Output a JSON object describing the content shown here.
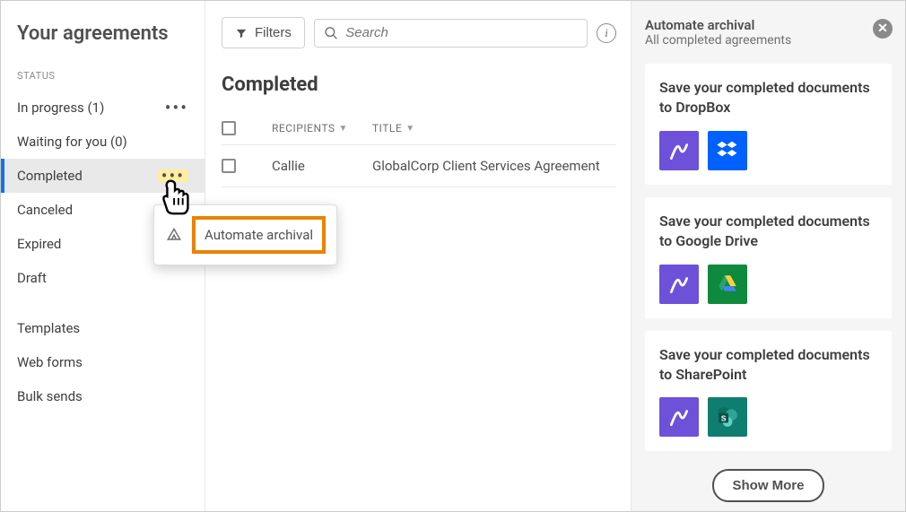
{
  "sidebar": {
    "title": "Your agreements",
    "status_label": "STATUS",
    "items": [
      {
        "label": "In progress (1)",
        "more": true
      },
      {
        "label": "Waiting for you (0)"
      },
      {
        "label": "Completed",
        "selected": true,
        "more_highlight": true
      },
      {
        "label": "Canceled"
      },
      {
        "label": "Expired"
      },
      {
        "label": "Draft"
      }
    ],
    "secondary": [
      {
        "label": "Templates"
      },
      {
        "label": "Web forms"
      },
      {
        "label": "Bulk sends"
      }
    ]
  },
  "toolbar": {
    "filters_label": "Filters",
    "search_placeholder": "Search"
  },
  "main": {
    "section_title": "Completed",
    "columns": {
      "recipients": "RECIPIENTS",
      "title": "TITLE"
    },
    "rows": [
      {
        "recipient": "Callie",
        "title": "GlobalCorp Client Services Agreement"
      }
    ]
  },
  "tooltip": {
    "automate_label": "Automate archival"
  },
  "panel": {
    "title": "Automate archival",
    "subtitle": "All completed agreements",
    "cards": [
      {
        "title": "Save your completed documents to DropBox"
      },
      {
        "title": "Save your completed documents to Google Drive"
      },
      {
        "title": "Save your completed documents to SharePoint"
      }
    ],
    "show_more": "Show More"
  }
}
